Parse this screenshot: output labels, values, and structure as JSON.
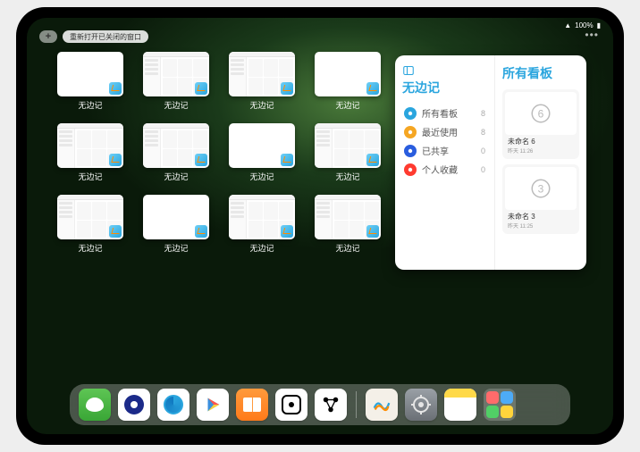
{
  "statusbar": {
    "wifi": "􀙇",
    "battery_pct": "100%"
  },
  "topbar": {
    "plus": "+",
    "reopen_label": "重新打开已关闭的窗口"
  },
  "expose": {
    "app_label": "无边记",
    "windows": [
      {
        "style": "blank"
      },
      {
        "style": "cal"
      },
      {
        "style": "cal"
      },
      {
        "style": "blank"
      },
      {
        "style": "cal"
      },
      {
        "style": "cal"
      },
      {
        "style": "blank"
      },
      {
        "style": "cal"
      },
      {
        "style": "cal"
      },
      {
        "style": "blank"
      },
      {
        "style": "cal"
      },
      {
        "style": "cal"
      }
    ]
  },
  "panel": {
    "left_title": "无边记",
    "nav": [
      {
        "icon_color": "#2aa5de",
        "label": "所有看板",
        "count": "8"
      },
      {
        "icon_color": "#f5a623",
        "label": "最近使用",
        "count": "8"
      },
      {
        "icon_color": "#2a5dde",
        "label": "已共享",
        "count": "0"
      },
      {
        "icon_color": "#ff3b30",
        "label": "个人收藏",
        "count": "0"
      }
    ],
    "right_title": "所有看板",
    "boards": [
      {
        "name": "未命名 6",
        "time": "昨天 11:26",
        "digit": "6"
      },
      {
        "name": "未命名 3",
        "time": "昨天 11:25",
        "digit": "3"
      }
    ]
  },
  "dock": {
    "apps": [
      {
        "name": "wechat"
      },
      {
        "name": "circle-blue"
      },
      {
        "name": "qqbrowser"
      },
      {
        "name": "play"
      },
      {
        "name": "books"
      },
      {
        "name": "dice"
      },
      {
        "name": "nodes"
      }
    ],
    "recent": [
      {
        "name": "freeform"
      },
      {
        "name": "settings"
      },
      {
        "name": "notes"
      }
    ]
  }
}
